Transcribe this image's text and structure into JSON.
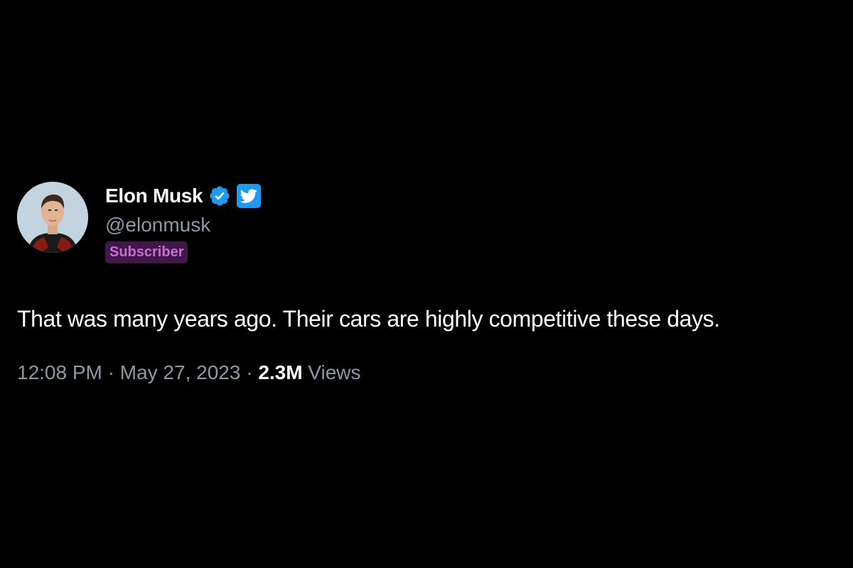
{
  "tweet": {
    "author": {
      "display_name": "Elon Musk",
      "handle": "@elonmusk",
      "badge_label": "Subscriber",
      "avatar_icon": "avatar-photo",
      "verified_icon": "verified-badge-icon",
      "platform_icon": "twitter-bird-icon"
    },
    "text": "That was many years ago. Their cars are highly competitive these days.",
    "meta": {
      "time": "12:08 PM",
      "separator": " · ",
      "date": "May 27, 2023",
      "views_count": "2.3M",
      "views_label": " Views"
    }
  },
  "colors": {
    "background": "#000000",
    "name": "#ffffff",
    "secondary_text": "#8b98a5",
    "verified_blue": "#1d9bf0",
    "subscriber_bg": "#3f1848",
    "subscriber_text": "#c86dd7"
  }
}
